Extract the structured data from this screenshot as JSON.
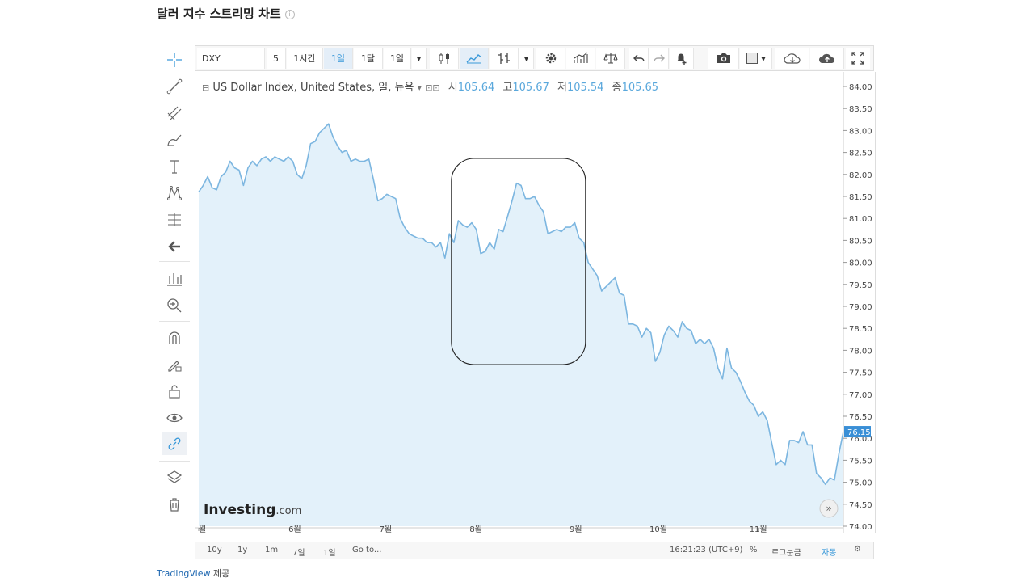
{
  "page": {
    "title": "달러 지수 스트리밍 차트",
    "provider_brand": "TradingView",
    "provider_suffix": "제공"
  },
  "toolbar": {
    "symbol": "DXY",
    "interval_5": "5",
    "interval_1h": "1시간",
    "interval_1d": "1일",
    "interval_1mo": "1달",
    "interval_custom": "1일"
  },
  "legend": {
    "instrument": "US Dollar Index, United States, 일, 뉴욕",
    "open_label": "시",
    "open": "105.64",
    "high_label": "고",
    "high": "105.67",
    "low_label": "저",
    "low": "105.54",
    "close_label": "종",
    "close": "105.65"
  },
  "watermark": {
    "brand": "Investing",
    "suffix": ".com"
  },
  "bottom_bar": {
    "ranges": [
      "10y",
      "1y",
      "1m",
      "7일",
      "1일"
    ],
    "goto": "Go to...",
    "time": "16:21:23 (UTC+9)",
    "percent": "%",
    "log": "로그눈금",
    "auto": "자동"
  },
  "colors": {
    "line": "#7cb6e0",
    "area": "#e3f1fa",
    "price_tag": "#3a8fd6",
    "active": "#3a99d9"
  },
  "chart_data": {
    "type": "area",
    "x_tick_labels": [
      "월",
      "6월",
      "7월",
      "8월",
      "9월",
      "10월",
      "11월"
    ],
    "y_ticks": [
      84.0,
      83.5,
      83.0,
      82.5,
      82.0,
      81.5,
      81.0,
      80.5,
      80.0,
      79.5,
      79.0,
      78.5,
      78.0,
      77.5,
      77.0,
      76.5,
      76.0,
      75.5,
      75.0,
      74.5,
      74.0
    ],
    "ylim": [
      74.0,
      84.0
    ],
    "last_price": "76.15",
    "highlight_box": {
      "x_from": 0.392,
      "x_to": 0.6
    },
    "values": [
      81.6,
      81.75,
      81.95,
      81.7,
      81.65,
      81.95,
      82.05,
      82.3,
      82.15,
      82.1,
      81.75,
      82.15,
      82.3,
      82.2,
      82.35,
      82.4,
      82.3,
      82.4,
      82.35,
      82.3,
      82.4,
      82.3,
      82.0,
      81.9,
      82.2,
      82.7,
      82.75,
      82.95,
      83.05,
      83.15,
      82.85,
      82.65,
      82.5,
      82.55,
      82.3,
      82.35,
      82.3,
      82.3,
      82.35,
      81.9,
      81.4,
      81.45,
      81.55,
      81.5,
      81.45,
      81.0,
      80.8,
      80.65,
      80.6,
      80.55,
      80.55,
      80.45,
      80.45,
      80.35,
      80.45,
      80.1,
      80.65,
      80.45,
      80.95,
      80.85,
      80.8,
      80.9,
      80.75,
      80.2,
      80.25,
      80.45,
      80.3,
      80.75,
      80.7,
      81.05,
      81.4,
      81.8,
      81.75,
      81.45,
      81.45,
      81.5,
      81.3,
      81.15,
      80.65,
      80.7,
      80.75,
      80.7,
      80.8,
      80.8,
      80.9,
      80.55,
      80.45,
      80.0,
      79.85,
      79.7,
      79.35,
      79.45,
      79.55,
      79.65,
      79.3,
      79.25,
      78.6,
      78.6,
      78.55,
      78.3,
      78.5,
      78.4,
      77.75,
      77.95,
      78.35,
      78.55,
      78.45,
      78.3,
      78.65,
      78.5,
      78.45,
      78.15,
      78.25,
      78.15,
      78.25,
      78.05,
      77.6,
      77.35,
      78.05,
      77.6,
      77.5,
      77.3,
      77.05,
      76.85,
      76.75,
      76.5,
      76.6,
      76.4,
      75.9,
      75.4,
      75.5,
      75.4,
      75.95,
      75.95,
      75.9,
      76.15,
      75.85,
      75.85,
      75.2,
      75.1,
      74.95,
      75.1,
      75.05,
      75.65,
      76.15
    ]
  }
}
